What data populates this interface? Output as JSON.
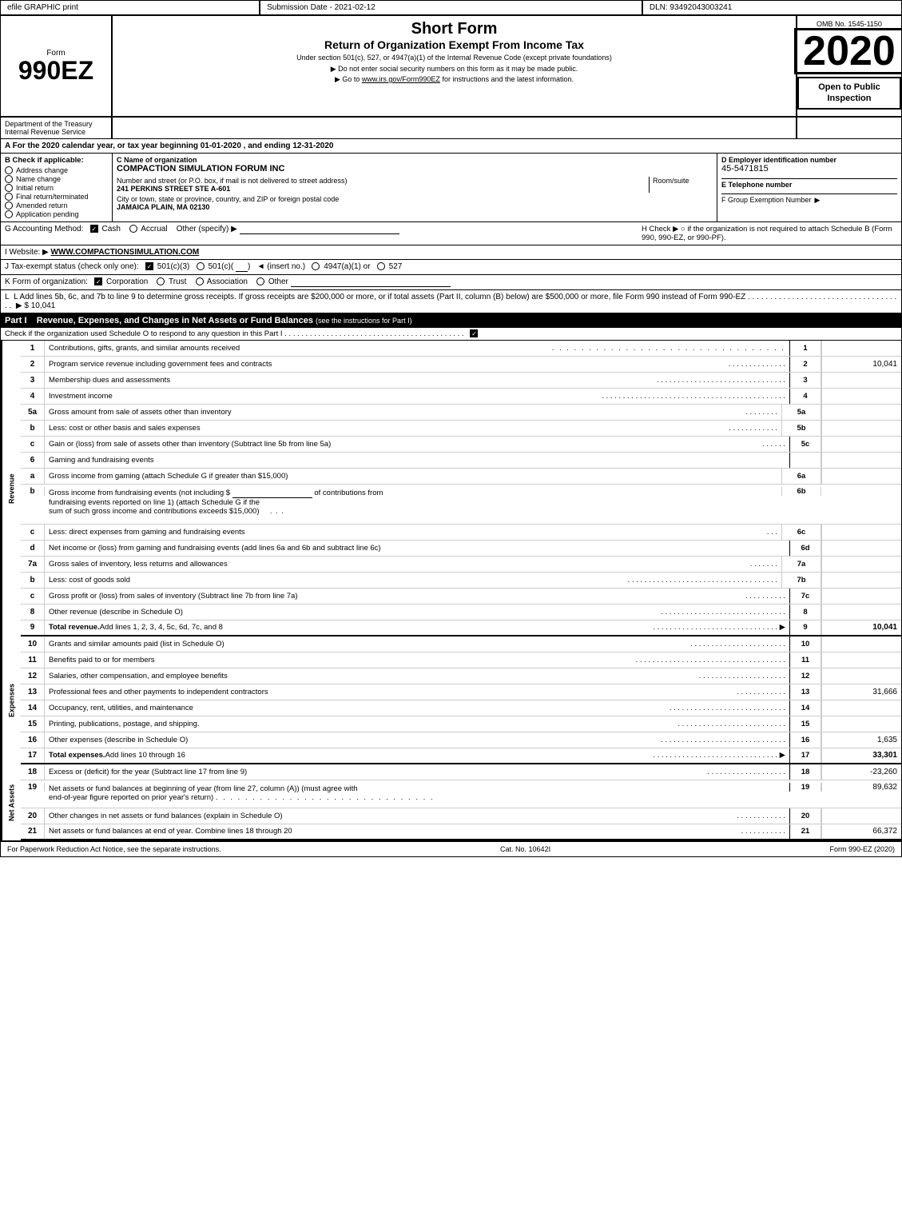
{
  "topBar": {
    "left": "efile GRAPHIC print",
    "mid": "Submission Date - 2021-02-12",
    "right": "DLN: 93492043003241"
  },
  "form": {
    "label": "Form",
    "number": "990EZ",
    "year": "2020",
    "title": "Short Form",
    "subtitle": "Return of Organization Exempt From Income Tax",
    "under": "Under section 501(c), 527, or 4947(a)(1) of the Internal Revenue Code (except private foundations)",
    "note1": "▶ Do not enter social security numbers on this form as it may be made public.",
    "note2": "▶ Go to www.irs.gov/Form990EZ for instructions and the latest information.",
    "omb": "OMB No. 1545-1150",
    "openToPublic": "Open to Public Inspection"
  },
  "department": {
    "name": "Department of the Treasury Internal Revenue Service"
  },
  "sectionA": {
    "text": "A  For the 2020 calendar year, or tax year beginning 01-01-2020 , and ending 12-31-2020"
  },
  "sectionB": {
    "label": "B Check if applicable:",
    "items": [
      "Address change",
      "Name change",
      "Initial return",
      "Final return/terminated",
      "Amended return",
      "Application pending"
    ],
    "checked": [
      "Address change",
      "Name change"
    ]
  },
  "orgName": {
    "label": "C Name of organization",
    "value": "COMPACTION SIMULATION FORUM INC",
    "addressLabel": "Number and street (or P.O. box, if mail is not delivered to street address)",
    "addressValue": "241 PERKINS STREET STE A-601",
    "roomSuiteLabel": "Room/suite",
    "roomSuiteValue": "",
    "cityLabel": "City or town, state or province, country, and ZIP or foreign postal code",
    "cityValue": "JAMAICA PLAIN, MA  02130"
  },
  "employerId": {
    "label": "D Employer identification number",
    "value": "45-5471815",
    "phoneLabel": "E Telephone number",
    "phoneValue": "",
    "groupLabel": "F Group Exemption Number",
    "groupValue": ""
  },
  "sectionG": {
    "label": "G Accounting Method:",
    "cash": "Cash",
    "accrual": "Accrual",
    "other": "Other (specify) ▶",
    "cashChecked": true,
    "hLabel": "H Check ▶",
    "hText": "○ if the organization is not required to attach Schedule B (Form 990, 990-EZ, or 990-PF)."
  },
  "sectionI": {
    "label": "I Website: ▶",
    "value": "WWW.COMPACTIONSIMULATION.COM"
  },
  "sectionJ": {
    "label": "J Tax-exempt status (check only one):",
    "options": [
      "501(c)(3)",
      "501(c)(   )",
      "◄ (insert no.)",
      "4947(a)(1) or",
      "527"
    ],
    "checked": "501(c)(3)"
  },
  "sectionK": {
    "label": "K Form of organization:",
    "options": [
      "Corporation",
      "Trust",
      "Association",
      "Other"
    ],
    "checked": "Corporation"
  },
  "sectionL": {
    "text": "L Add lines 5b, 6c, and 7b to line 9 to determine gross receipts. If gross receipts are $200,000 or more, or if total assets (Part II, column (B) below) are $500,000 or more, file Form 990 instead of Form 990-EZ",
    "dots": ". . . . . . . . . . . . . . . . . . . . . . . . . . . . . . . . . . . .",
    "arrow": "▶ $",
    "value": "10,041"
  },
  "partI": {
    "title": "Part I",
    "heading": "Revenue, Expenses, and Changes in Net Assets or Fund Balances",
    "headingNote": "(see the instructions for Part I)",
    "checkNote": "Check if the organization used Schedule O to respond to any question in this Part I",
    "rows": [
      {
        "num": "1",
        "desc": "Contributions, gifts, grants, and similar amounts received",
        "lineNum": "1",
        "amount": ""
      },
      {
        "num": "2",
        "desc": "Program service revenue including government fees and contracts",
        "lineNum": "2",
        "amount": "10,041"
      },
      {
        "num": "3",
        "desc": "Membership dues and assessments",
        "lineNum": "3",
        "amount": ""
      },
      {
        "num": "4",
        "desc": "Investment income",
        "lineNum": "4",
        "amount": ""
      },
      {
        "num": "5a",
        "desc": "Gross amount from sale of assets other than inventory",
        "lineRef": "5a",
        "lineNum": "",
        "amount": ""
      },
      {
        "num": "b",
        "desc": "Less: cost or other basis and sales expenses",
        "lineRef": "5b",
        "lineNum": "",
        "amount": ""
      },
      {
        "num": "c",
        "desc": "Gain or (loss) from sale of assets other than inventory (Subtract line 5b from line 5a)",
        "lineNum": "5c",
        "amount": ""
      },
      {
        "num": "6",
        "desc": "Gaming and fundraising events",
        "lineNum": "",
        "amount": ""
      },
      {
        "num": "a",
        "desc": "Gross income from gaming (attach Schedule G if greater than $15,000)",
        "lineRef": "6a",
        "lineNum": "",
        "amount": ""
      },
      {
        "num": "b",
        "desc": "Gross income from fundraising events (not including $ _____________ of contributions from fundraising events reported on line 1) (attach Schedule G if the sum of such gross income and contributions exceeds $15,000)",
        "lineRef": "6b",
        "lineNum": "",
        "amount": ""
      },
      {
        "num": "c",
        "desc": "Less: direct expenses from gaming and fundraising events",
        "lineRef": "6c",
        "lineNum": "",
        "amount": ""
      },
      {
        "num": "d",
        "desc": "Net income or (loss) from gaming and fundraising events (add lines 6a and 6b and subtract line 6c)",
        "lineNum": "6d",
        "amount": ""
      },
      {
        "num": "7a",
        "desc": "Gross sales of inventory, less returns and allowances",
        "lineRef": "7a",
        "lineNum": "",
        "amount": ""
      },
      {
        "num": "b",
        "desc": "Less: cost of goods sold",
        "lineRef": "7b",
        "lineNum": "",
        "amount": ""
      },
      {
        "num": "c",
        "desc": "Gross profit or (loss) from sales of inventory (Subtract line 7b from line 7a)",
        "lineNum": "7c",
        "amount": ""
      },
      {
        "num": "8",
        "desc": "Other revenue (describe in Schedule O)",
        "lineNum": "8",
        "amount": ""
      },
      {
        "num": "9",
        "desc": "Total revenue. Add lines 1, 2, 3, 4, 5c, 6d, 7c, and 8",
        "lineNum": "9",
        "amount": "10,041",
        "bold": true
      }
    ]
  },
  "partIExpenses": {
    "rows": [
      {
        "num": "10",
        "desc": "Grants and similar amounts paid (list in Schedule O)",
        "lineNum": "10",
        "amount": ""
      },
      {
        "num": "11",
        "desc": "Benefits paid to or for members",
        "lineNum": "11",
        "amount": ""
      },
      {
        "num": "12",
        "desc": "Salaries, other compensation, and employee benefits",
        "lineNum": "12",
        "amount": ""
      },
      {
        "num": "13",
        "desc": "Professional fees and other payments to independent contractors",
        "lineNum": "13",
        "amount": "31,666"
      },
      {
        "num": "14",
        "desc": "Occupancy, rent, utilities, and maintenance",
        "lineNum": "14",
        "amount": ""
      },
      {
        "num": "15",
        "desc": "Printing, publications, postage, and shipping.",
        "lineNum": "15",
        "amount": ""
      },
      {
        "num": "16",
        "desc": "Other expenses (describe in Schedule O)",
        "lineNum": "16",
        "amount": "1,635"
      },
      {
        "num": "17",
        "desc": "Total expenses. Add lines 10 through 16",
        "lineNum": "17",
        "amount": "33,301",
        "bold": true
      }
    ]
  },
  "partINetAssets": {
    "rows": [
      {
        "num": "18",
        "desc": "Excess or (deficit) for the year (Subtract line 17 from line 9)",
        "lineNum": "18",
        "amount": "-23,260"
      },
      {
        "num": "19",
        "desc": "Net assets or fund balances at beginning of year (from line 27, column (A)) (must agree with end-of-year figure reported on prior year's return)",
        "lineNum": "19",
        "amount": "89,632"
      },
      {
        "num": "20",
        "desc": "Other changes in net assets or fund balances (explain in Schedule O)",
        "lineNum": "20",
        "amount": ""
      },
      {
        "num": "21",
        "desc": "Net assets or fund balances at end of year. Combine lines 18 through 20",
        "lineNum": "21",
        "amount": "66,372"
      }
    ]
  },
  "footer": {
    "left": "For Paperwork Reduction Act Notice, see the separate instructions.",
    "mid": "Cat. No. 10642I",
    "right": "Form 990-EZ (2020)"
  }
}
